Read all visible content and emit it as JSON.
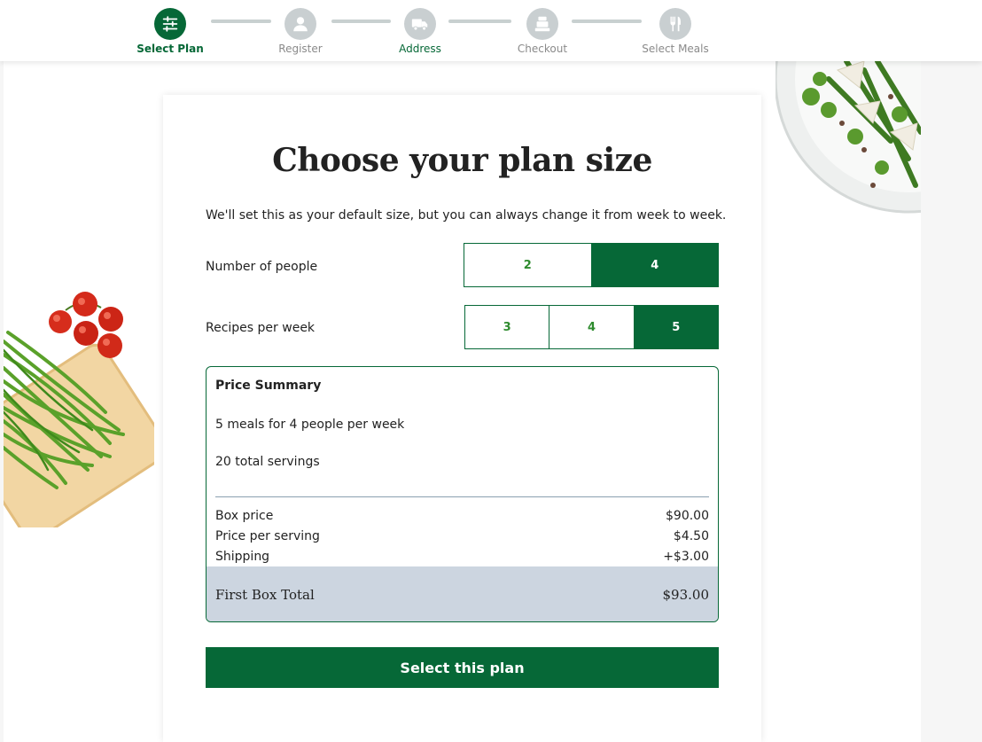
{
  "stepper": {
    "steps": [
      {
        "label": "Select Plan",
        "icon": "sliders-icon"
      },
      {
        "label": "Register",
        "icon": "user-icon"
      },
      {
        "label": "Address",
        "icon": "truck-icon"
      },
      {
        "label": "Checkout",
        "icon": "cash-register-icon"
      },
      {
        "label": "Select Meals",
        "icon": "fork-knife-icon"
      }
    ],
    "active_color": "#066837",
    "inactive_color": "#c9cfd1"
  },
  "plan": {
    "title": "Choose your plan size",
    "subtitle": "We'll set this as your default size, but you can always change it from week to week.",
    "people": {
      "label": "Number of people",
      "options": [
        "2",
        "4"
      ],
      "selected": "4"
    },
    "recipes": {
      "label": "Recipes per week",
      "options": [
        "3",
        "4",
        "5"
      ],
      "selected": "5"
    }
  },
  "summary": {
    "title": "Price Summary",
    "line1": "5 meals for 4 people per week",
    "line2": "20 total servings",
    "rows": [
      {
        "label": "Box price",
        "value": "$90.00"
      },
      {
        "label": "Price per serving",
        "value": "$4.50"
      },
      {
        "label": "Shipping",
        "value": "+$3.00"
      }
    ],
    "total_label": "First Box Total",
    "total_value": "$93.00"
  },
  "cta": {
    "label": "Select this plan"
  },
  "colors": {
    "brand_green": "#066837",
    "option_text_green": "#2e8b2e",
    "total_bar": "#ccd5e0"
  }
}
